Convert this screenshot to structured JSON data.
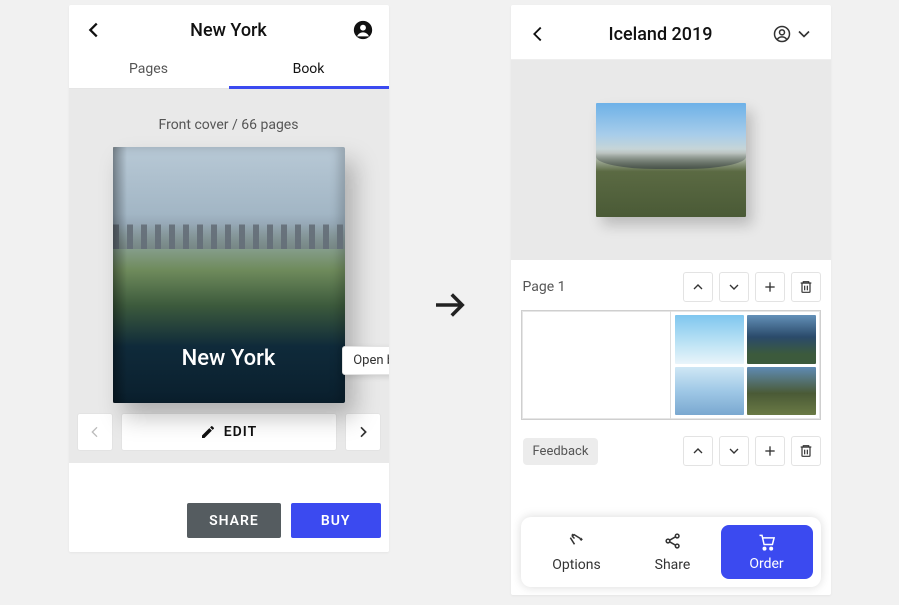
{
  "left": {
    "title": "New York",
    "tabs": {
      "pages": "Pages",
      "book": "Book",
      "active": "book"
    },
    "book_meta": "Front cover / 66 pages",
    "cover_title": "New York",
    "open_book_tip": "Open book",
    "edit_label": "EDIT",
    "share_label": "SHARE",
    "buy_label": "BUY"
  },
  "right": {
    "title": "Iceland 2019",
    "page_label": "Page 1",
    "feedback_label": "Feedback",
    "bottom": {
      "options": "Options",
      "share": "Share",
      "order": "Order"
    }
  }
}
